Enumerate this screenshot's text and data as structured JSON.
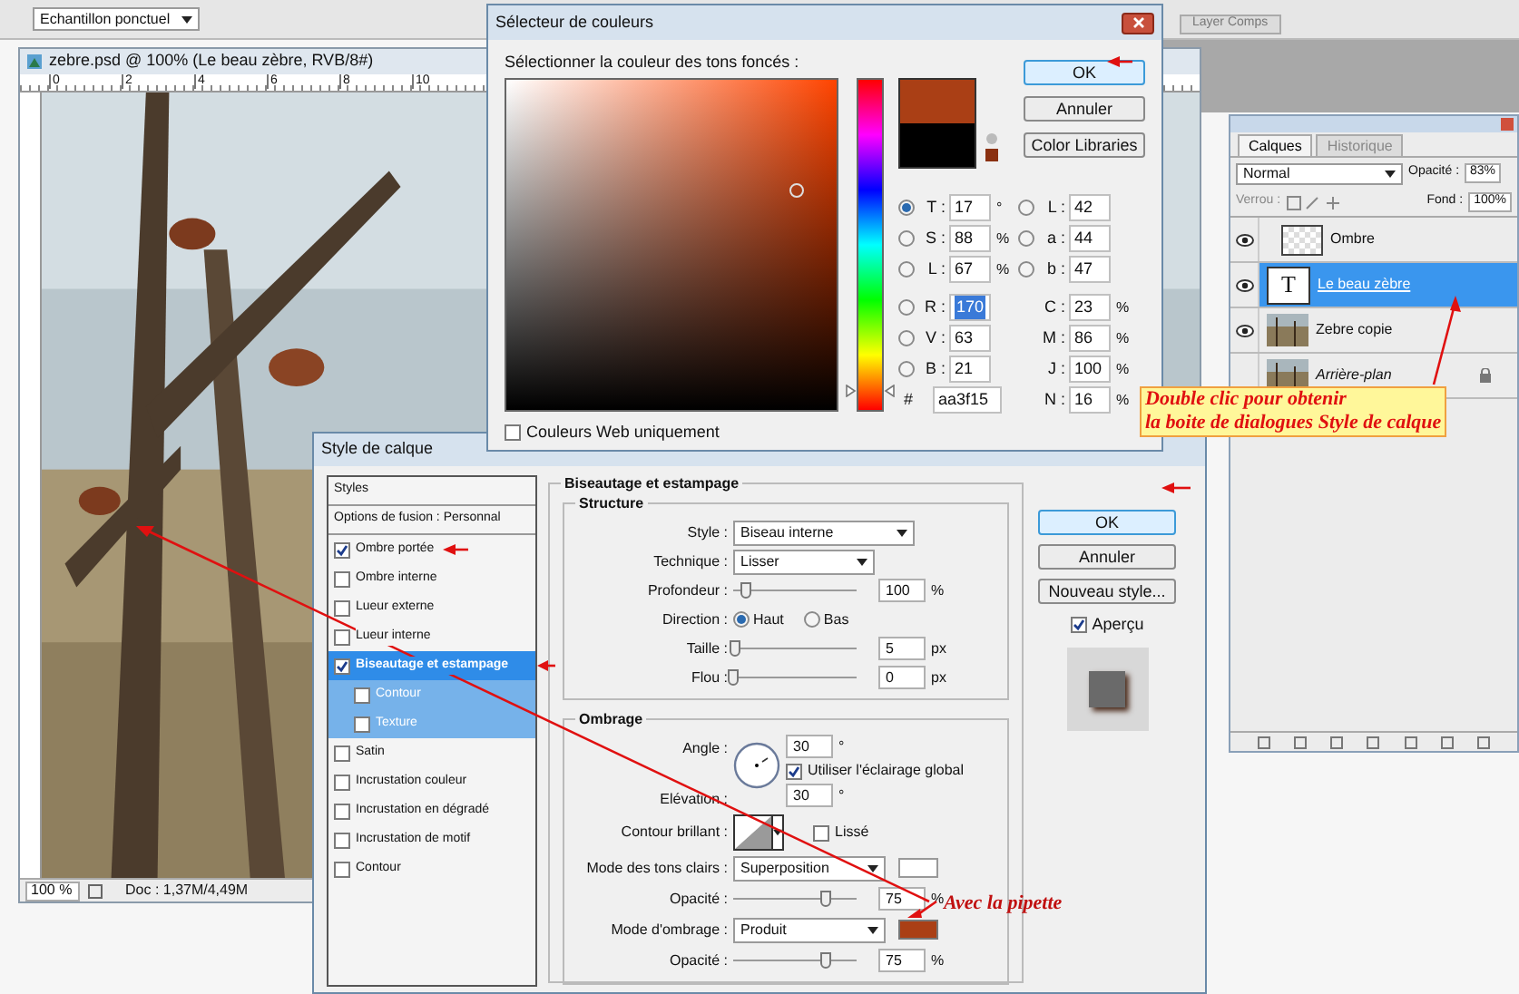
{
  "options_bar": {
    "sample_dropdown": "Echantillon ponctuel"
  },
  "panel_tab": "Layer Comps",
  "document": {
    "title": "zebre.psd @ 100% (Le beau zèbre, RVB/8#)",
    "ruler_labels": [
      "0",
      "2",
      "4",
      "6",
      "8",
      "10"
    ],
    "zoom": "100 %",
    "doc_info": "Doc : 1,37M/4,49M"
  },
  "color_picker": {
    "title": "Sélecteur de couleurs",
    "prompt": "Sélectionner la couleur des tons foncés :",
    "hue_slider": {
      "level": 0.06
    },
    "new_swatch": {
      "color": "#aa3f15"
    },
    "old_swatch": {
      "color": "#000000"
    },
    "buttons": [
      "OK",
      "Annuler",
      "Color Libraries"
    ],
    "hsb": [
      {
        "label": "T :",
        "value": "17",
        "unit": "°",
        "selected": true
      },
      {
        "label": "S :",
        "value": "88",
        "unit": "%",
        "selected": false
      },
      {
        "label": "L :",
        "value": "67",
        "unit": "%",
        "selected": false
      }
    ],
    "rgb": [
      {
        "label": "R :",
        "value": "170",
        "selected": false,
        "highlighted": true
      },
      {
        "label": "V :",
        "value": "63",
        "selected": false,
        "highlighted": false
      },
      {
        "label": "B :",
        "value": "21",
        "selected": false,
        "highlighted": false
      }
    ],
    "lab": [
      {
        "label": "L :",
        "value": "42",
        "selected": false
      },
      {
        "label": "a :",
        "value": "44",
        "selected": false
      },
      {
        "label": "b :",
        "value": "47",
        "selected": false
      }
    ],
    "cmyk": [
      {
        "label": "C :",
        "value": "23",
        "unit": "%"
      },
      {
        "label": "M :",
        "value": "86",
        "unit": "%"
      },
      {
        "label": "J :",
        "value": "100",
        "unit": "%"
      },
      {
        "label": "N :",
        "value": "16",
        "unit": "%"
      }
    ],
    "hex_label": "#",
    "hex": "aa3f15",
    "web_only": {
      "label": "Couleurs Web uniquement",
      "checked": false
    }
  },
  "layer_style": {
    "title": "Style de calque",
    "styles_header": "Styles",
    "blending_options": "Options de fusion : Personnal",
    "effects": [
      {
        "label": "Ombre portée",
        "checked": true,
        "selected": false
      },
      {
        "label": "Ombre interne",
        "checked": false,
        "selected": false
      },
      {
        "label": "Lueur externe",
        "checked": false,
        "selected": false
      },
      {
        "label": "Lueur interne",
        "checked": false,
        "selected": false
      },
      {
        "label": "Biseautage et estampage",
        "checked": true,
        "selected": true,
        "children": [
          {
            "label": "Contour",
            "checked": false
          },
          {
            "label": "Texture",
            "checked": false
          }
        ]
      },
      {
        "label": "Satin",
        "checked": false,
        "selected": false
      },
      {
        "label": "Incrustation couleur",
        "checked": false,
        "selected": false
      },
      {
        "label": "Incrustation en dégradé",
        "checked": false,
        "selected": false
      },
      {
        "label": "Incrustation de motif",
        "checked": false,
        "selected": false
      },
      {
        "label": "Contour",
        "checked": false,
        "selected": false
      }
    ],
    "section_title": "Biseautage et estampage",
    "structure": {
      "title": "Structure",
      "style": {
        "label": "Style :",
        "value": "Biseau interne"
      },
      "technique": {
        "label": "Technique :",
        "value": "Lisser"
      },
      "depth": {
        "label": "Profondeur :",
        "level": 0.1,
        "value": "100",
        "unit": "%"
      },
      "direction": {
        "label": "Direction :",
        "options": [
          {
            "label": "Haut",
            "selected": true
          },
          {
            "label": "Bas",
            "selected": false
          }
        ]
      },
      "size": {
        "label": "Taille :",
        "level": 0.02,
        "value": "5",
        "unit": "px"
      },
      "soften": {
        "label": "Flou :",
        "level": 0,
        "value": "0",
        "unit": "px"
      }
    },
    "shading": {
      "title": "Ombrage",
      "angle": {
        "label": "Angle :",
        "value": "30",
        "unit": "°"
      },
      "global_light": {
        "label": "Utiliser l'éclairage global",
        "checked": true
      },
      "altitude": {
        "label": "Elévation :",
        "value": "30",
        "unit": "°"
      },
      "gloss_contour": {
        "label": "Contour brillant :"
      },
      "anti_aliased": {
        "label": "Lissé",
        "checked": false
      },
      "highlight": {
        "label": "Mode des tons clairs :",
        "value": "Superposition",
        "color": "#ffffff"
      },
      "highlight_opacity": {
        "label": "Opacité :",
        "level": 0.75,
        "value": "75",
        "unit": "%"
      },
      "shadow": {
        "label": "Mode d'ombrage :",
        "value": "Produit",
        "color": "#aa3f15"
      },
      "shadow_opacity": {
        "label": "Opacité :",
        "level": 0.75,
        "value": "75",
        "unit": "%"
      }
    },
    "buttons": [
      "OK",
      "Annuler",
      "Nouveau style..."
    ],
    "preview": {
      "label": "Aperçu",
      "checked": true
    }
  },
  "layers_panel": {
    "tabs": [
      {
        "label": "Calques",
        "selected": true
      },
      {
        "label": "Historique",
        "selected": false
      }
    ],
    "blend_mode": "Normal",
    "opacity_label": "Opacité :",
    "opacity": "83%",
    "lock_label": "Verrou :",
    "fill_label": "Fond :",
    "fill": "100%",
    "layers": [
      {
        "name": "Ombre",
        "kind": "transparent",
        "visible": true,
        "selected": false,
        "locked": false
      },
      {
        "name": "Le beau zèbre",
        "kind": "text",
        "thumb_text": "T",
        "visible": true,
        "selected": true,
        "locked": false
      },
      {
        "name": "Zebre copie",
        "visible": true,
        "selected": false,
        "locked": false
      },
      {
        "name": "Arrière-plan",
        "visible": false,
        "selected": false,
        "locked": true
      }
    ]
  },
  "annotations": {
    "callout": [
      "Double clic pour obtenir",
      "la boite de dialogues Style de calque"
    ],
    "pipette_note": "Avec la pipette"
  }
}
